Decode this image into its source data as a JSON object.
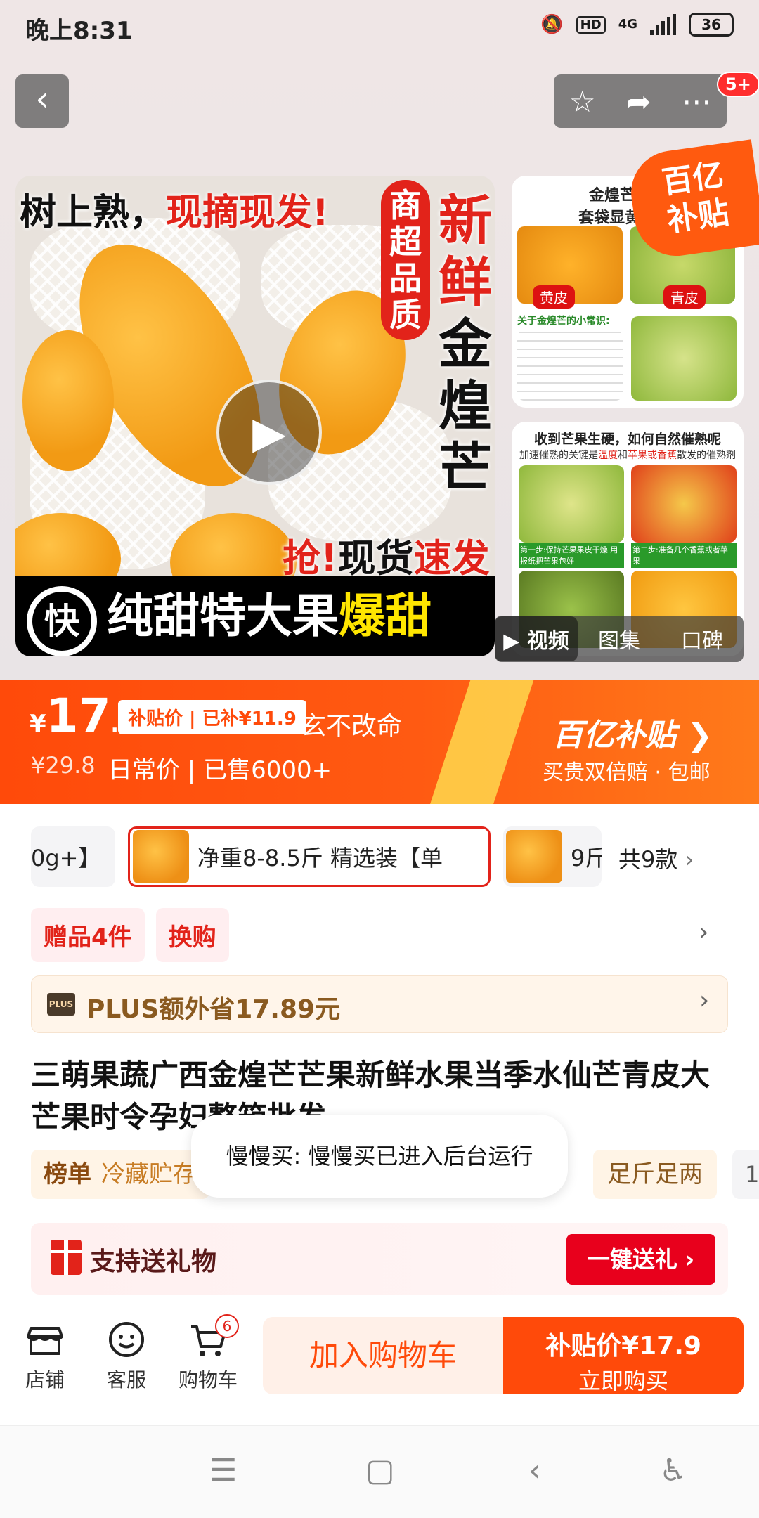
{
  "status_bar": {
    "time": "晚上8:31",
    "network": "4G",
    "hd": "HD",
    "battery": "36"
  },
  "header": {
    "back_icon": "back-arrow-icon",
    "actions": [
      "star-icon",
      "share-icon",
      "more-icon"
    ],
    "message_badge": "5+"
  },
  "gallery": {
    "main_top_text_black": "树上熟，",
    "main_top_text_red": "现摘现发!",
    "vertical_tag": "商超品质",
    "vertical_title_red": "新鲜",
    "vertical_title_black": "金煌芒",
    "grab_red": "抢!",
    "grab_black": "现货",
    "grab_red2": "速发",
    "bottom_white": "纯甜特大果",
    "bottom_yellow": "爆甜",
    "fast_badge": "快",
    "side1_title": "金煌芒分青",
    "side1_title2": "套袋显黄色 不",
    "side1_label_yellow": "黄皮",
    "side1_label_green": "青皮",
    "side1_tip": "关于金煌芒的小常识:",
    "side2_title": "收到芒果生硬，如何自然催熟呢",
    "side2_sub_black": "加速催熟的关键是",
    "side2_sub_red": "温度",
    "side2_sub_mid": "和",
    "side2_sub_red2": "苹果或香蕉",
    "side2_sub_end": "散发的催熟剂",
    "side2_step1": "第一步:保持芒果果皮干燥 用报纸把芒果包好",
    "side2_step2": "第二步:准备几个香蕉或者苹果",
    "yi_badge_line1": "百亿",
    "yi_badge_line2": "补贴",
    "media_tabs": [
      "视频",
      "图集",
      "口碑"
    ]
  },
  "price": {
    "currency": "¥",
    "integer": "17",
    "decimal": ".9",
    "subsidy_tag": "补贴价 | 已补¥11.9",
    "slogan": "玄不改命",
    "old_price": "¥29.8",
    "info": "日常价 | 已售6000+",
    "brand": "百亿补贴",
    "brand_sub": "买贵双倍赔 · 包邮"
  },
  "sku": {
    "items": [
      "0g+】",
      "净重8-8.5斤  精选装【单",
      "9斤"
    ],
    "count": "共9款"
  },
  "tags": [
    "赠品4件",
    "换购"
  ],
  "plus": {
    "logo": "PLUS",
    "text": "PLUS额外省17.89元"
  },
  "title": "三萌果蔬广西金煌芒芒果新鲜水果当季水仙芒青皮大芒果时令孕妇整箱批发",
  "rank": {
    "label": "榜单",
    "text": "冷藏贮存",
    "tag": "足斤足两",
    "tag2": "1"
  },
  "toast": "慢慢买: 慢慢买已进入后台运行",
  "gift": {
    "text": "支持送礼物",
    "button": "一键送礼 ›"
  },
  "bottom_bar": {
    "shop": "店铺",
    "service": "客服",
    "cart": "购物车",
    "cart_count": "6",
    "add_cart": "加入购物车",
    "buy_line1": "补贴价¥17.9",
    "buy_line2": "立即购买"
  },
  "nav": [
    "menu-icon",
    "home-icon",
    "back-icon",
    "accessibility-icon"
  ]
}
